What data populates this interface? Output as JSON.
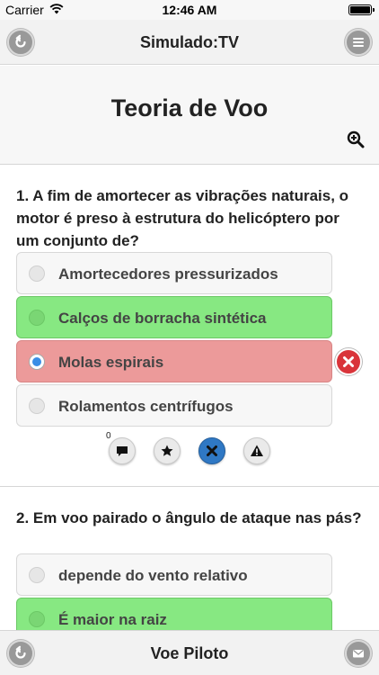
{
  "status": {
    "carrier": "Carrier",
    "time": "12:46 AM"
  },
  "nav": {
    "title": "Simulado:TV"
  },
  "header": {
    "title": "Teoria de Voo"
  },
  "questions": [
    {
      "text": "1. A fim de amortecer as vibrações naturais, o motor é preso à estrutura do helicóptero por um conjunto de?",
      "options": [
        {
          "label": "Amortecedores pressurizados",
          "state": "neutral"
        },
        {
          "label": "Calços de borracha sintética",
          "state": "correct"
        },
        {
          "label": "Molas espirais",
          "state": "wrong-selected"
        },
        {
          "label": "Rolamentos centrífugos",
          "state": "neutral"
        }
      ],
      "comment_count": "0"
    },
    {
      "text": "2. Em voo pairado o ângulo de ataque nas pás?",
      "options": [
        {
          "label": "depende do vento relativo",
          "state": "neutral"
        },
        {
          "label": "É maior na raiz",
          "state": "correct"
        }
      ]
    }
  ],
  "bottom": {
    "title": "Voe Piloto"
  },
  "colors": {
    "correct": "#87e882",
    "wrong": "#ec9a9a",
    "selected_radio": "#3a8ee6",
    "error_mark": "#d9343a",
    "active_action": "#2f78c4"
  },
  "icons": {
    "nav_left": "back-arrow-icon",
    "nav_right": "menu-icon",
    "zoom": "zoom-in-icon",
    "wrong": "close-icon",
    "actions": [
      "comment-icon",
      "star-icon",
      "close-icon",
      "warning-icon"
    ],
    "bottom_left": "back-arrow-icon",
    "bottom_right": "mail-icon"
  }
}
